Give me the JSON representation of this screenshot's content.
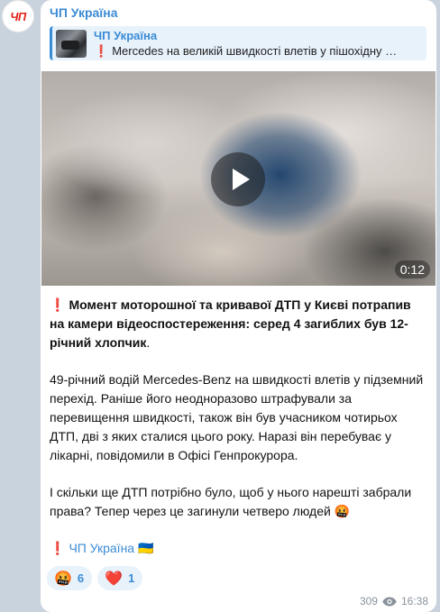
{
  "channel": {
    "avatar_text": "ЧП",
    "name": "ЧП Україна"
  },
  "forward": {
    "source": "ЧП Україна",
    "excl": "❗",
    "preview": "Mercedes на великій швидкості влетів у пішохідну …"
  },
  "video": {
    "duration": "0:12"
  },
  "post": {
    "excl": "❗",
    "headline": "Момент моторошної та кривавої ДТП у Києві потрапив на камери відеоспостереження: серед 4 загиблих був 12-річний хлопчик",
    "headline_end": ".",
    "paragraph2": "49-річний водій Mercedes-Benz на швидкості влетів у підземний перехід. Раніше його неодноразово штрафували за перевищення швидкості, також він був учасником чотирьох ДТП, дві з яких сталися цього року. Наразі він перебуває у лікарні, повідомили в Офісі Генпрокурора.",
    "paragraph3": "І скільки ще ДТП потрібно було, щоб у нього нарешті забрали права? Тепер через це загинули четверо людей 🤬",
    "sig_excl": "❗",
    "signature": "ЧП Україна 🇺🇦"
  },
  "reactions": [
    {
      "emoji": "🤬",
      "count": "6"
    },
    {
      "emoji": "❤️",
      "count": "1"
    }
  ],
  "meta": {
    "views": "309",
    "time": "16:38"
  }
}
